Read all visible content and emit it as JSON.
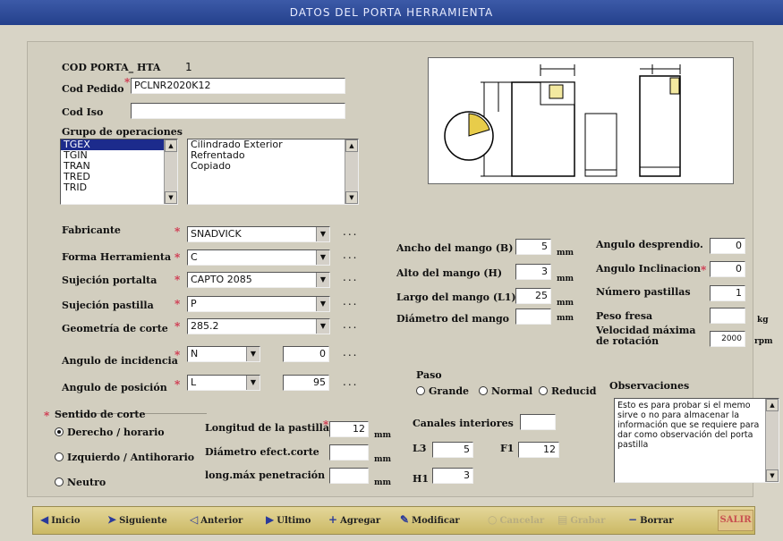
{
  "window": {
    "title": "DATOS DEL PORTA HERRAMIENTA"
  },
  "codigo": {
    "label": "COD PORTA_ HTA",
    "value": "1"
  },
  "cod_pedido": {
    "label": "Cod Pedido",
    "value": "PCLNR2020K12"
  },
  "cod_iso": {
    "label": "Cod Iso",
    "value": ""
  },
  "grupo_operaciones": {
    "label": "Grupo de operaciones",
    "codes": [
      "TGEX",
      "TGIN",
      "TRAN",
      "TRED",
      "TRID"
    ],
    "selected_index": 0,
    "descriptions": [
      "Cilindrado Exterior",
      "Refrentado",
      "Copiado"
    ]
  },
  "fabricante": {
    "label": "Fabricante",
    "value": "SNADVICK"
  },
  "forma_herramienta": {
    "label": "Forma Herramienta",
    "value": "C"
  },
  "sujecion_portalta": {
    "label": "Sujeción portalta",
    "value": "CAPTO 2085"
  },
  "sujecion_pastilla": {
    "label": "Sujeción pastilla",
    "value": "P"
  },
  "geometria_corte": {
    "label": "Geometría de corte",
    "value": "285.2"
  },
  "angulo_incidencia": {
    "label": "Angulo de incidencia",
    "value": "N",
    "number": "0"
  },
  "angulo_posicion": {
    "label": "Angulo de posición",
    "value": "L",
    "number": "95"
  },
  "dots": "...",
  "mango": {
    "ancho": {
      "label": "Ancho del mango (B)",
      "value": "5",
      "unit": "mm"
    },
    "alto": {
      "label": "Alto del mango (H)",
      "value": "3",
      "unit": "mm"
    },
    "largo": {
      "label": "Largo del mango (L1)",
      "value": "25",
      "unit": "mm"
    },
    "diametro": {
      "label": "Diámetro del mango",
      "value": "",
      "unit": "mm"
    }
  },
  "angulos": {
    "desprendido": {
      "label": "Angulo desprendio.",
      "value": "0"
    },
    "inclinacion": {
      "label": "Angulo Inclinacion",
      "value": "0"
    },
    "pastillas": {
      "label": "Número pastillas",
      "value": "1"
    },
    "peso": {
      "label": "Peso fresa",
      "value": "",
      "unit": "kg"
    },
    "velocidad": {
      "label": "Velocidad máxima de rotación",
      "value": "2000",
      "unit": "rpm"
    }
  },
  "paso": {
    "label": "Paso",
    "options": [
      "Grande",
      "Normal",
      "Reducid"
    ],
    "selected_index": -1
  },
  "observaciones": {
    "label": "Observaciones",
    "text": "Esto es para probar si el memo sirve o no para almacenar la información que se requiere para dar como observación del porta pastilla"
  },
  "sentido_corte": {
    "label": "Sentido de corte",
    "options": [
      "Derecho / horario",
      "Izquierdo / Antihorario",
      "Neutro"
    ],
    "selected_index": 0
  },
  "pastilla": {
    "longitud": {
      "label": "Longitud de la pastilla",
      "value": "12",
      "unit": "mm"
    },
    "diametro": {
      "label": "Diámetro efect.corte",
      "value": "",
      "unit": "mm"
    },
    "penetracion": {
      "label": "long.máx penetración",
      "value": "",
      "unit": "mm"
    }
  },
  "canales": {
    "label": "Canales interiores",
    "value": ""
  },
  "l3": {
    "label": "L3",
    "value": "5"
  },
  "f1": {
    "label": "F1",
    "value": "12"
  },
  "h1": {
    "label": "H1",
    "value": "3"
  },
  "toolbar": {
    "inicio": "Inicio",
    "siguiente": "Siguiente",
    "anterior": "Anterior",
    "ultimo": "Ultimo",
    "agregar": "Agregar",
    "modificar": "Modificar",
    "cancelar": "Cancelar",
    "grabar": "Grabar",
    "borrar": "Borrar",
    "salir": "SALIR"
  },
  "icons": {
    "inicio": "arrow-left-icon",
    "siguiente": "cursor-icon",
    "anterior": "back-icon",
    "ultimo": "arrow-right-icon",
    "agregar": "add-icon",
    "modificar": "edit-icon",
    "borrar": "delete-icon"
  }
}
